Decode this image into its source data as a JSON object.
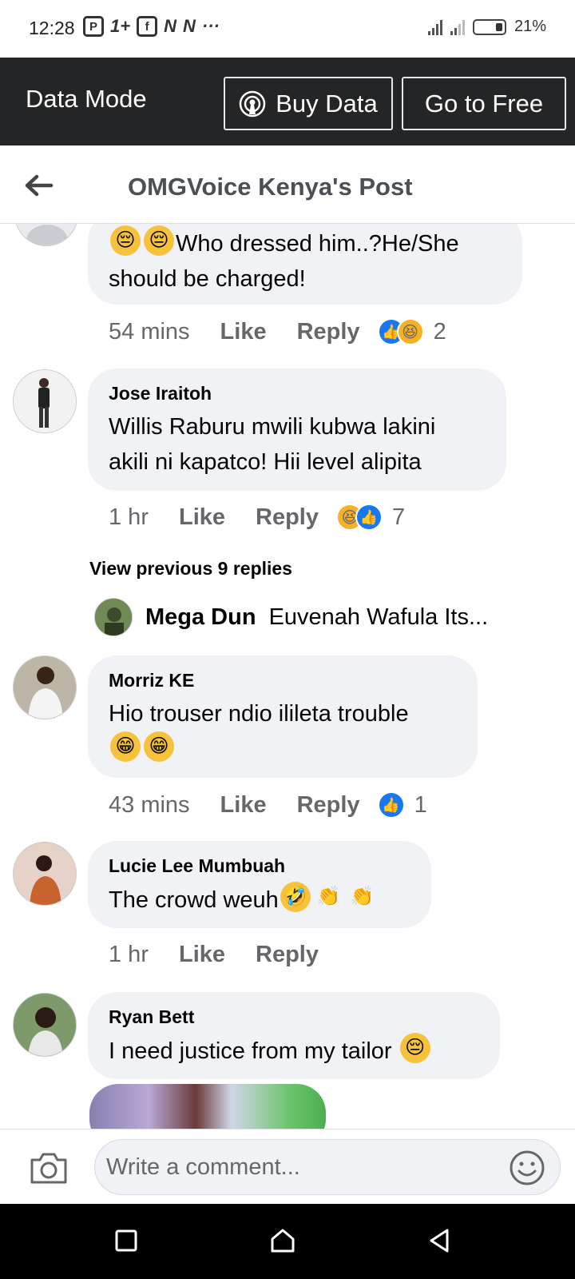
{
  "status_bar": {
    "time": "12:28",
    "battery": "21%",
    "more": "···",
    "icons": [
      "P",
      "1+",
      "f",
      "N",
      "N"
    ]
  },
  "data_bar": {
    "title": "Data Mode",
    "buy_label": "Buy Data",
    "free_label": "Go to Free"
  },
  "header": {
    "title": "OMGVoice Kenya's Post"
  },
  "comments": [
    {
      "name": "",
      "text": "Who dressed him..?He/She should be charged!",
      "time": "54 mins",
      "like": "Like",
      "reply": "Reply",
      "reaction_count": "2"
    },
    {
      "name": "Jose Iraitoh",
      "text_line1": "Willis Raburu mwili kubwa lakini",
      "text_line2": "akili ni kapatco! Hii level alipita",
      "time": "1 hr",
      "like": "Like",
      "reply": "Reply",
      "reaction_count": "7"
    },
    {
      "name": "Morriz KE",
      "text": "Hio trouser ndio ilileta trouble",
      "time": "43 mins",
      "like": "Like",
      "reply": "Reply",
      "reaction_count": "1"
    },
    {
      "name": "Lucie Lee Mumbuah",
      "text": "The crowd weuh",
      "time": "1 hr",
      "like": "Like",
      "reply": "Reply"
    },
    {
      "name": "Ryan Bett",
      "text": "I need justice from my tailor"
    }
  ],
  "view_previous": "View previous 9 replies",
  "reply_preview": {
    "name": "Mega Dun",
    "text": "Euvenah Wafula Its..."
  },
  "composer": {
    "placeholder": "Write a comment..."
  },
  "colors": {
    "data_bar": "#242526",
    "bubble": "#f0f2f5",
    "like_blue": "#1877f2",
    "muted": "#65676b"
  }
}
